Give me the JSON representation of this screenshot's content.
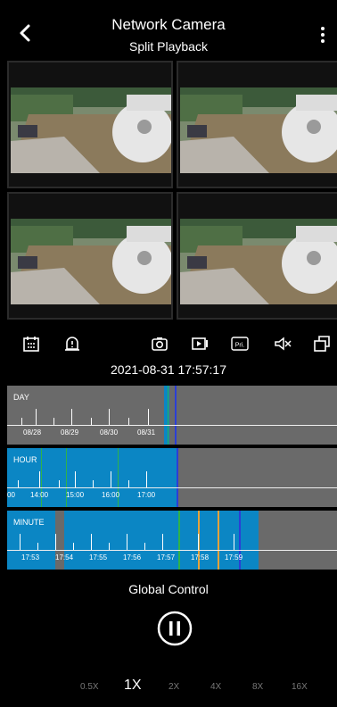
{
  "header": {
    "title": "Network Camera",
    "subtitle": "Split Playback"
  },
  "datetime": "2021-08-31 17:57:17",
  "timeline": {
    "day": {
      "label": "DAY",
      "ticks": [
        "08/28",
        "08/29",
        "08/30",
        "08/31"
      ]
    },
    "hour": {
      "label": "HOUR",
      "ticks": [
        "00",
        "14:00",
        "15:00",
        "16:00",
        "17:00"
      ]
    },
    "minute": {
      "label": "MINUTE",
      "ticks": [
        "17:53",
        "17:54",
        "17:55",
        "17:56",
        "17:57",
        "17:58",
        "17:59"
      ]
    }
  },
  "global_control": "Global Control",
  "speeds": [
    "0.5X",
    "1X",
    "2X",
    "4X",
    "8X",
    "16X"
  ],
  "speed_selected": "1X",
  "icons": {
    "back": "back-icon",
    "more": "more-icon",
    "calendar": "calendar-icon",
    "alarm": "alarm-icon",
    "snapshot": "camera-icon",
    "record": "record-icon",
    "pri": "pri-icon",
    "mute": "mute-icon",
    "rotate": "rotate-icon"
  },
  "colors": {
    "record": "#0b86c4",
    "accent_green": "#2fb24a",
    "accent_orange": "#e7a23a",
    "cursor": "#2b3ed6"
  }
}
